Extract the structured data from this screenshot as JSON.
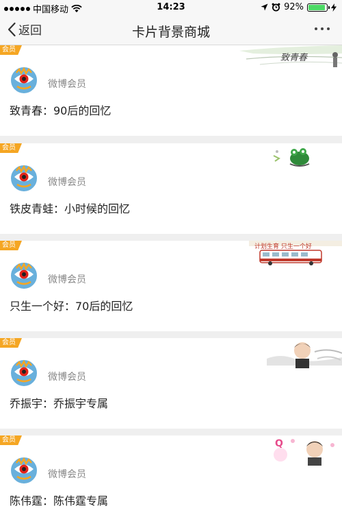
{
  "status_bar": {
    "carrier": "中国移动",
    "time": "14:23",
    "battery_percent": "92%",
    "battery_level": 0.92
  },
  "nav": {
    "back_label": "返回",
    "title": "卡片背景商城"
  },
  "cards": [
    {
      "badge": "会员",
      "member_label": "微博会员",
      "title": "致青春：90后的回忆",
      "decor": "youth-sketch"
    },
    {
      "badge": "会员",
      "member_label": "微博会员",
      "title": "铁皮青蛙：小时候的回忆",
      "decor": "tin-frog"
    },
    {
      "badge": "会员",
      "member_label": "微博会员",
      "title": "只生一个好：70后的回忆",
      "decor": "old-bus"
    },
    {
      "badge": "会员",
      "member_label": "微博会员",
      "title": "乔振宇：乔振宇专属",
      "decor": "portrait"
    },
    {
      "badge": "会员",
      "member_label": "微博会员",
      "title": "陈伟霆：陈伟霆专属",
      "decor": "portrait-pink"
    }
  ],
  "colors": {
    "badge": "#f5a623",
    "avatar_bg": "#69b0dc",
    "battery": "#4cd964"
  }
}
